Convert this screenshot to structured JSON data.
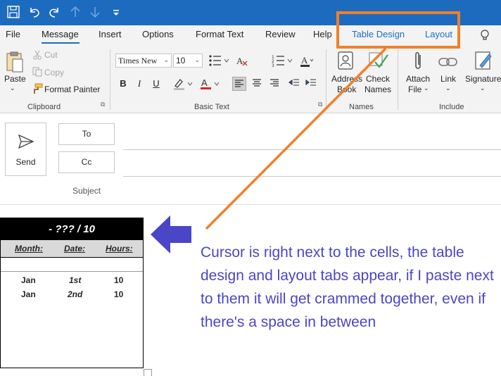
{
  "quick_access": {
    "icons": [
      "save-icon",
      "undo-icon",
      "redo-icon",
      "up-arrow-icon",
      "down-arrow-icon",
      "customize-icon"
    ]
  },
  "tabs": {
    "file": "File",
    "message": "Message",
    "insert": "Insert",
    "options": "Options",
    "format_text": "Format Text",
    "review": "Review",
    "help": "Help",
    "table_design": "Table Design",
    "layout": "Layout"
  },
  "ribbon": {
    "clipboard": {
      "paste": "Paste",
      "cut": "Cut",
      "copy": "Copy",
      "format_painter": "Format Painter",
      "label": "Clipboard"
    },
    "basic_text": {
      "font": "Times New",
      "size": "10",
      "bold": "B",
      "italic": "I",
      "underline": "U",
      "label": "Basic Text"
    },
    "names": {
      "address_book_1": "Address",
      "address_book_2": "Book",
      "check_names_1": "Check",
      "check_names_2": "Names",
      "label": "Names"
    },
    "include": {
      "attach_1": "Attach",
      "attach_2": "File",
      "link_1": "Link",
      "signature_1": "Signature",
      "label": "Include"
    }
  },
  "compose": {
    "send": "Send",
    "to": "To",
    "cc": "Cc",
    "subject": "Subject"
  },
  "doc_table": {
    "title": "- ??? / 10",
    "headers": [
      "Month:",
      "Date:",
      "Hours:"
    ],
    "rows": [
      {
        "month": "Jan",
        "date": "1st",
        "hours": "10"
      },
      {
        "month": "Jan",
        "date": "2nd",
        "hours": "10"
      }
    ]
  },
  "annotation": {
    "text": "Cursor is right next to the cells, the table design and layout tabs appear, if I paste next to them it will get crammed together, even if there's a space in between",
    "box_color": "#f0802a",
    "arrow_color": "#4a46c6"
  }
}
